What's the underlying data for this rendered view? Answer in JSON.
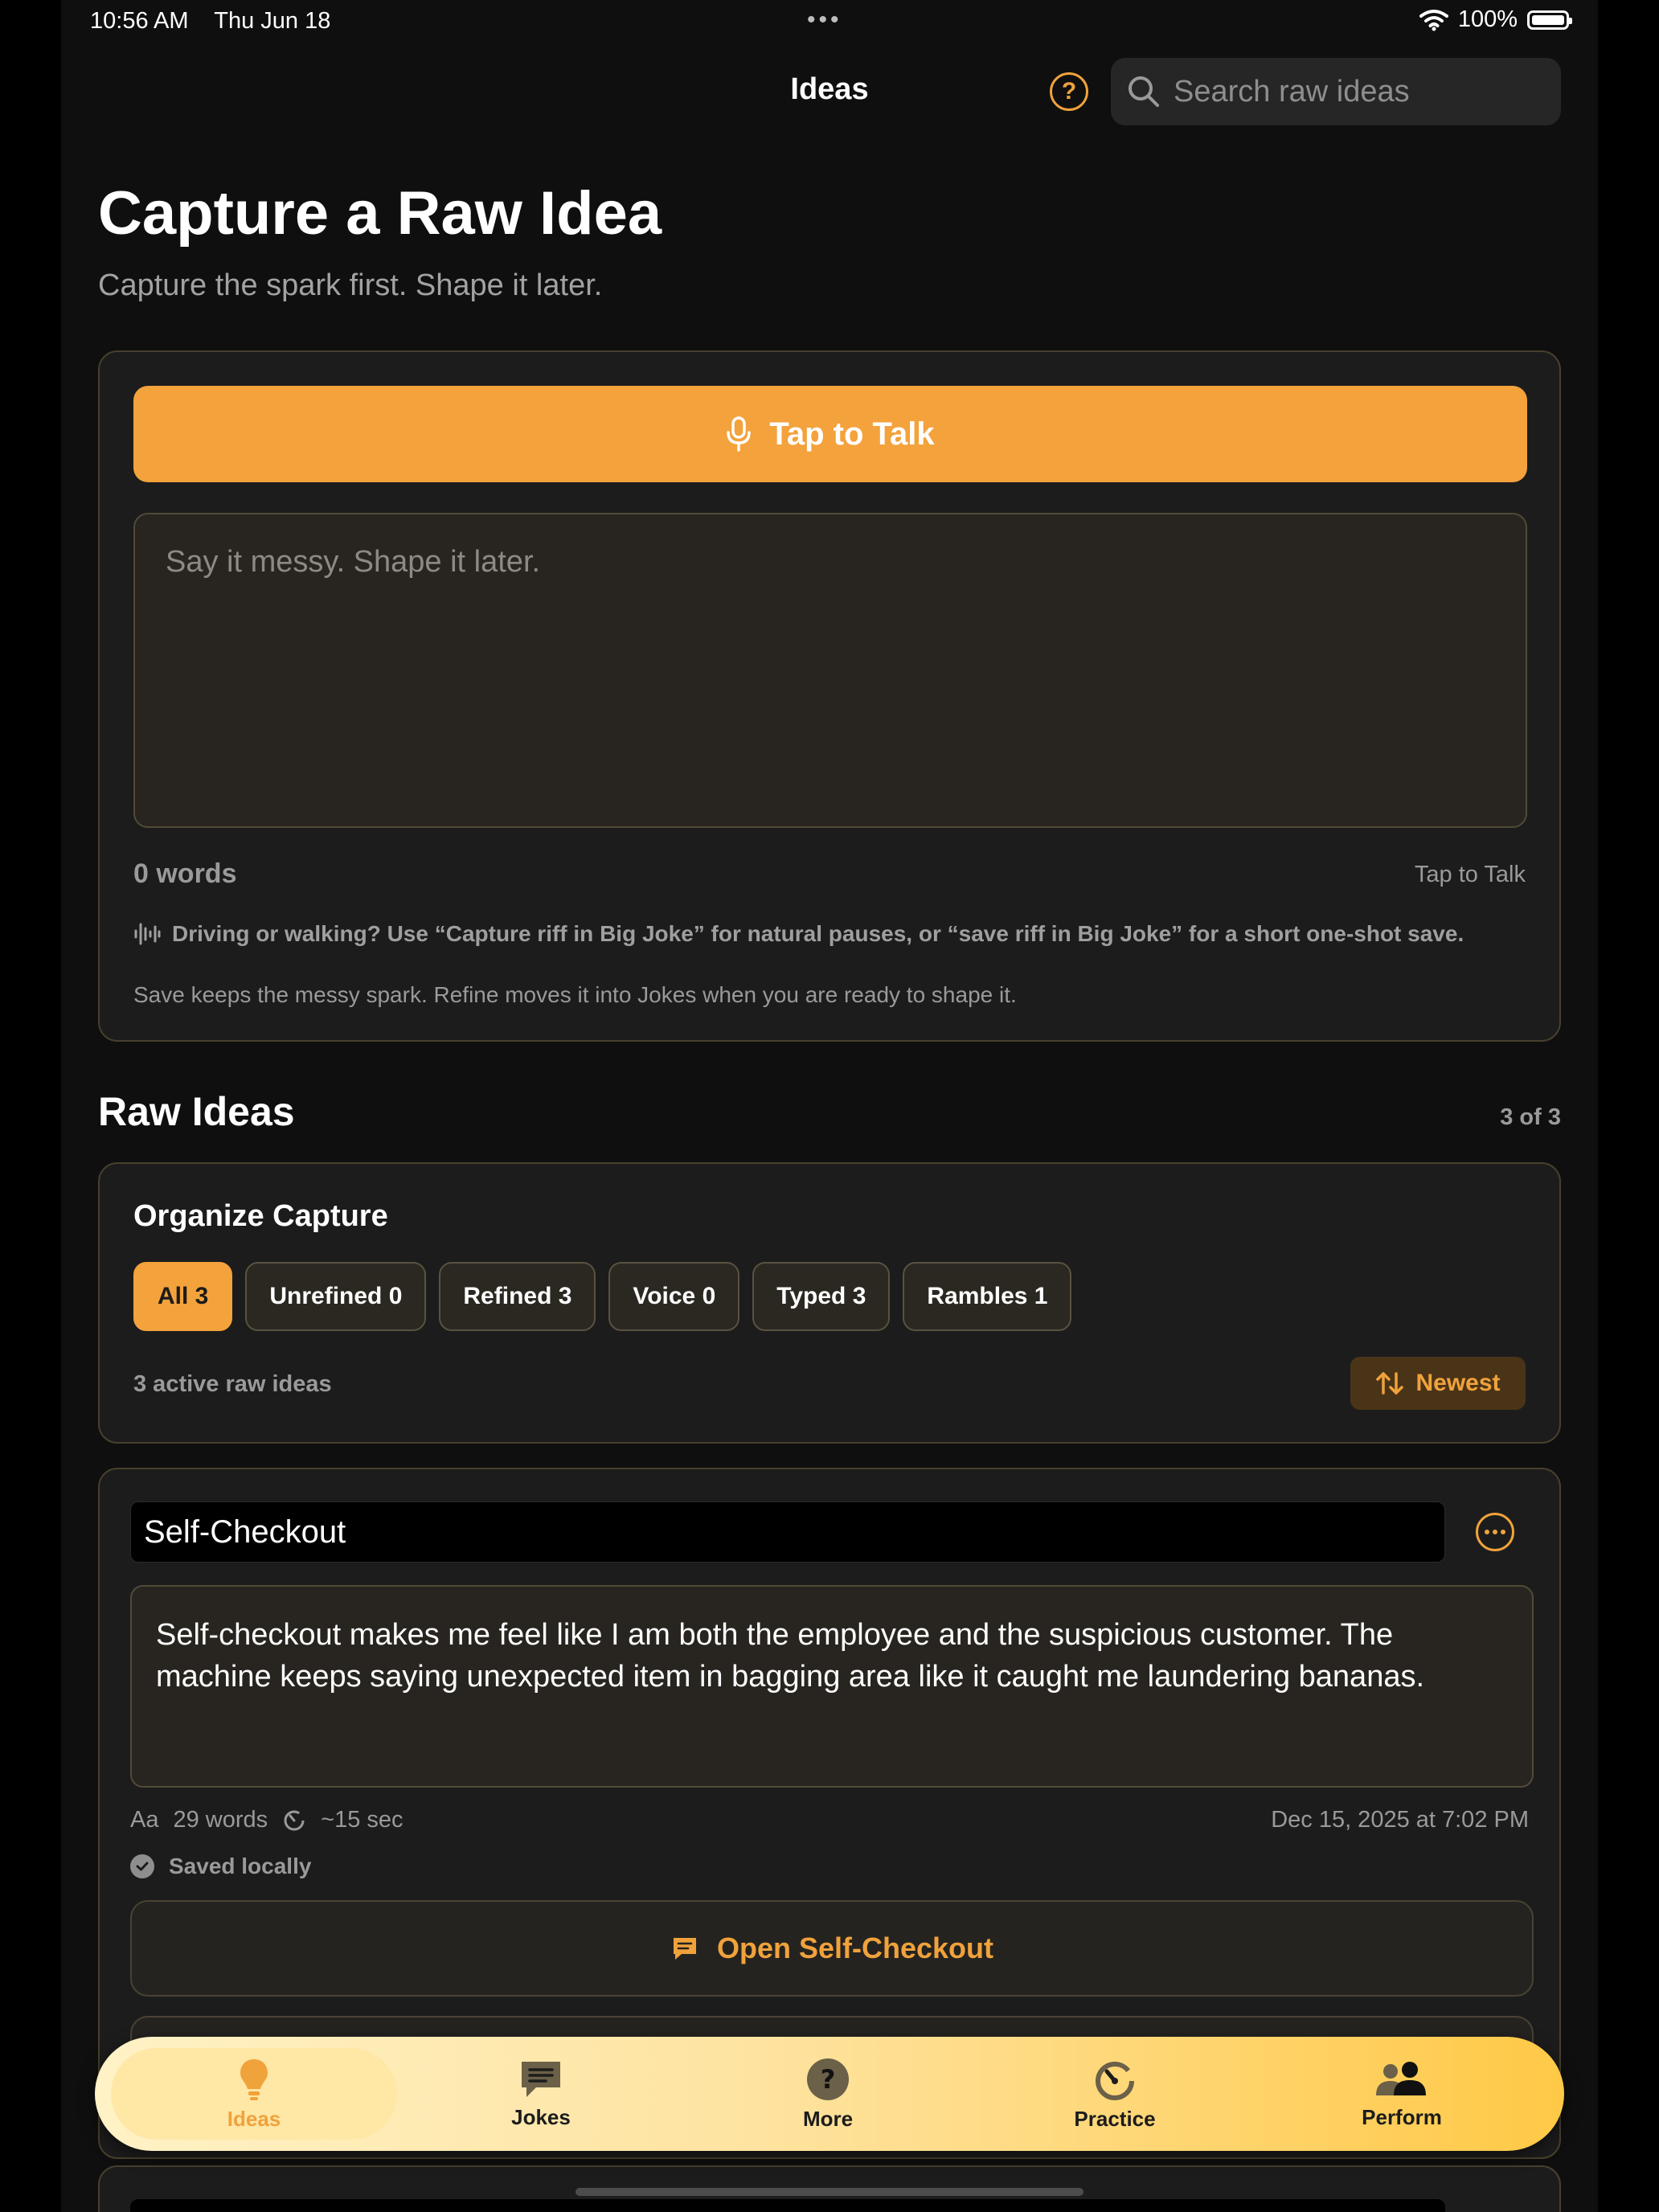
{
  "status_bar": {
    "time": "10:56 AM",
    "date": "Thu Jun 18",
    "battery": "100%"
  },
  "nav": {
    "title": "Ideas",
    "help_symbol": "?",
    "search_placeholder": "Search raw ideas"
  },
  "header": {
    "title": "Capture a Raw Idea",
    "subtitle": "Capture the spark first. Shape it later."
  },
  "capture": {
    "talk_button": "Tap to Talk",
    "placeholder": "Say it messy. Shape it later.",
    "word_count": "0 words",
    "talk_link": "Tap to Talk",
    "tip": "Driving or walking? Use “Capture riff in Big Joke” for natural pauses, or “save riff in Big Joke” for a short one-shot save.",
    "note": "Save keeps the messy spark. Refine moves it into Jokes when you are ready to shape it."
  },
  "raw_ideas": {
    "title": "Raw Ideas",
    "count": "3 of 3"
  },
  "organize": {
    "title": "Organize Capture",
    "filters": [
      {
        "label": "All 3",
        "active": true
      },
      {
        "label": "Unrefined 0",
        "active": false
      },
      {
        "label": "Refined 3",
        "active": false
      },
      {
        "label": "Voice 0",
        "active": false
      },
      {
        "label": "Typed 3",
        "active": false
      },
      {
        "label": "Rambles 1",
        "active": false
      }
    ],
    "active_count": "3 active raw ideas",
    "sort_label": "Newest"
  },
  "idea": {
    "title": "Self-Checkout",
    "body": "Self-checkout makes me feel like I am both the employee and the suspicious customer. The machine keeps saying unexpected item in bagging area like it caught me laundering bananas.",
    "font_label": "Aa",
    "words": "29 words",
    "duration": "~15 sec",
    "date": "Dec 15, 2025 at 7:02 PM",
    "saved": "Saved locally",
    "open_button": "Open Self-Checkout"
  },
  "tabs": [
    {
      "label": "Ideas",
      "icon": "lightbulb-icon",
      "active": true
    },
    {
      "label": "Jokes",
      "icon": "message-icon",
      "active": false
    },
    {
      "label": "More",
      "icon": "question-icon",
      "active": false
    },
    {
      "label": "Practice",
      "icon": "timer-icon",
      "active": false
    },
    {
      "label": "Perform",
      "icon": "people-icon",
      "active": false
    }
  ],
  "colors": {
    "accent": "#F3A23C",
    "background": "#0F0F0F",
    "card": "#1C1C1C"
  }
}
